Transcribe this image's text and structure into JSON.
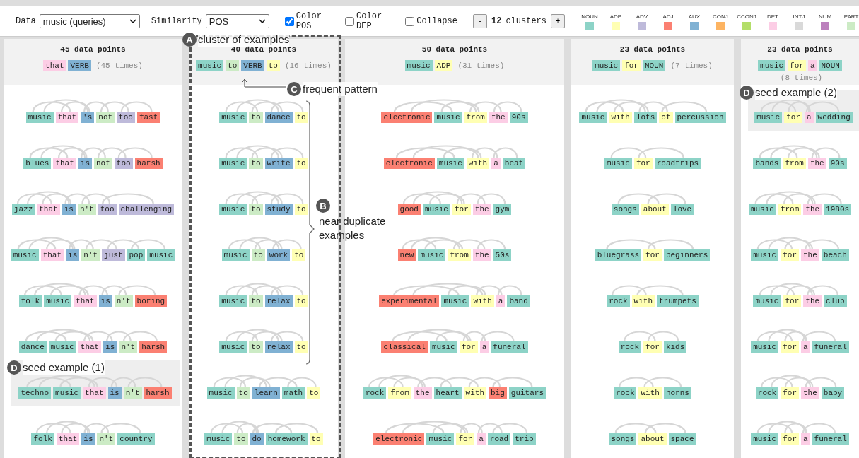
{
  "toolbar": {
    "data_label": "Data",
    "data_value": "music (queries)",
    "similarity_label": "Similarity",
    "similarity_value": "POS",
    "checkboxes": [
      {
        "label": "Color POS",
        "checked": true
      },
      {
        "label": "Color DEP",
        "checked": false
      },
      {
        "label": "Collapse",
        "checked": false
      }
    ],
    "minus": "-",
    "count": "12",
    "count_label": "clusters",
    "plus": "+"
  },
  "legend": [
    {
      "label": "NOUN",
      "color": "#8dd3c7"
    },
    {
      "label": "ADP",
      "color": "#ffffb3"
    },
    {
      "label": "ADV",
      "color": "#bebada"
    },
    {
      "label": "ADJ",
      "color": "#fb8072"
    },
    {
      "label": "AUX",
      "color": "#80b1d3"
    },
    {
      "label": "CONJ",
      "color": "#fdb462"
    },
    {
      "label": "CCONJ",
      "color": "#b3de69"
    },
    {
      "label": "DET",
      "color": "#fccde5"
    },
    {
      "label": "INTJ",
      "color": "#d9d9d9"
    },
    {
      "label": "NUM",
      "color": "#bc80bd"
    },
    {
      "label": "PART",
      "color": "#ccebc5"
    }
  ],
  "clusters": [
    {
      "count_text": "45 data points",
      "pattern": [
        {
          "text": "that",
          "color": "#fccde5"
        },
        {
          "text": "VERB",
          "color": "#80b1d3"
        }
      ],
      "times": "(45 times)",
      "examples": [
        {
          "seed": false,
          "tokens": [
            {
              "text": "music",
              "color": "#8dd3c7"
            },
            {
              "text": "that",
              "color": "#fccde5"
            },
            {
              "text": "'s",
              "color": "#80b1d3"
            },
            {
              "text": "not",
              "color": "#ccebc5"
            },
            {
              "text": "too",
              "color": "#bebada"
            },
            {
              "text": "fast",
              "color": "#fb8072"
            }
          ]
        },
        {
          "seed": false,
          "tokens": [
            {
              "text": "blues",
              "color": "#8dd3c7"
            },
            {
              "text": "that",
              "color": "#fccde5"
            },
            {
              "text": "is",
              "color": "#80b1d3"
            },
            {
              "text": "not",
              "color": "#ccebc5"
            },
            {
              "text": "too",
              "color": "#bebada"
            },
            {
              "text": "harsh",
              "color": "#fb8072"
            }
          ]
        },
        {
          "seed": false,
          "tokens": [
            {
              "text": "jazz",
              "color": "#8dd3c7"
            },
            {
              "text": "that",
              "color": "#fccde5"
            },
            {
              "text": "is",
              "color": "#80b1d3"
            },
            {
              "text": "n't",
              "color": "#ccebc5"
            },
            {
              "text": "too",
              "color": "#bebada"
            },
            {
              "text": "challenging",
              "color": "#bebada"
            }
          ]
        },
        {
          "seed": false,
          "tokens": [
            {
              "text": "music",
              "color": "#8dd3c7"
            },
            {
              "text": "that",
              "color": "#fccde5"
            },
            {
              "text": "is",
              "color": "#80b1d3"
            },
            {
              "text": "n't",
              "color": "#ccebc5"
            },
            {
              "text": "just",
              "color": "#bebada"
            },
            {
              "text": "pop",
              "color": "#8dd3c7"
            },
            {
              "text": "music",
              "color": "#8dd3c7"
            }
          ]
        },
        {
          "seed": false,
          "tokens": [
            {
              "text": "folk",
              "color": "#8dd3c7"
            },
            {
              "text": "music",
              "color": "#8dd3c7"
            },
            {
              "text": "that",
              "color": "#fccde5"
            },
            {
              "text": "is",
              "color": "#80b1d3"
            },
            {
              "text": "n't",
              "color": "#ccebc5"
            },
            {
              "text": "boring",
              "color": "#fb8072"
            }
          ]
        },
        {
          "seed": false,
          "tokens": [
            {
              "text": "dance",
              "color": "#8dd3c7"
            },
            {
              "text": "music",
              "color": "#8dd3c7"
            },
            {
              "text": "that",
              "color": "#fccde5"
            },
            {
              "text": "is",
              "color": "#80b1d3"
            },
            {
              "text": "n't",
              "color": "#ccebc5"
            },
            {
              "text": "harsh",
              "color": "#fb8072"
            }
          ]
        },
        {
          "seed": true,
          "tokens": [
            {
              "text": "techno",
              "color": "#8dd3c7"
            },
            {
              "text": "music",
              "color": "#8dd3c7"
            },
            {
              "text": "that",
              "color": "#fccde5"
            },
            {
              "text": "is",
              "color": "#80b1d3"
            },
            {
              "text": "n't",
              "color": "#ccebc5"
            },
            {
              "text": "harsh",
              "color": "#fb8072"
            }
          ]
        },
        {
          "seed": false,
          "tokens": [
            {
              "text": "folk",
              "color": "#8dd3c7"
            },
            {
              "text": "that",
              "color": "#fccde5"
            },
            {
              "text": "is",
              "color": "#80b1d3"
            },
            {
              "text": "n't",
              "color": "#ccebc5"
            },
            {
              "text": "country",
              "color": "#8dd3c7"
            }
          ]
        }
      ]
    },
    {
      "count_text": "40 data points",
      "pattern": [
        {
          "text": "music",
          "color": "#8dd3c7"
        },
        {
          "text": "to",
          "color": "#ccebc5"
        },
        {
          "text": "VERB",
          "color": "#80b1d3"
        },
        {
          "text": "to",
          "color": "#ffffb3"
        }
      ],
      "times": "(16 times)",
      "examples": [
        {
          "seed": false,
          "tokens": [
            {
              "text": "music",
              "color": "#8dd3c7"
            },
            {
              "text": "to",
              "color": "#ccebc5"
            },
            {
              "text": "dance",
              "color": "#80b1d3"
            },
            {
              "text": "to",
              "color": "#ffffb3"
            }
          ]
        },
        {
          "seed": false,
          "tokens": [
            {
              "text": "music",
              "color": "#8dd3c7"
            },
            {
              "text": "to",
              "color": "#ccebc5"
            },
            {
              "text": "write",
              "color": "#80b1d3"
            },
            {
              "text": "to",
              "color": "#ffffb3"
            }
          ]
        },
        {
          "seed": false,
          "tokens": [
            {
              "text": "music",
              "color": "#8dd3c7"
            },
            {
              "text": "to",
              "color": "#ccebc5"
            },
            {
              "text": "study",
              "color": "#80b1d3"
            },
            {
              "text": "to",
              "color": "#ffffb3"
            }
          ]
        },
        {
          "seed": false,
          "tokens": [
            {
              "text": "music",
              "color": "#8dd3c7"
            },
            {
              "text": "to",
              "color": "#ccebc5"
            },
            {
              "text": "work",
              "color": "#80b1d3"
            },
            {
              "text": "to",
              "color": "#ffffb3"
            }
          ]
        },
        {
          "seed": false,
          "tokens": [
            {
              "text": "music",
              "color": "#8dd3c7"
            },
            {
              "text": "to",
              "color": "#ccebc5"
            },
            {
              "text": "relax",
              "color": "#80b1d3"
            },
            {
              "text": "to",
              "color": "#ffffb3"
            }
          ]
        },
        {
          "seed": false,
          "tokens": [
            {
              "text": "music",
              "color": "#8dd3c7"
            },
            {
              "text": "to",
              "color": "#ccebc5"
            },
            {
              "text": "relax",
              "color": "#80b1d3"
            },
            {
              "text": "to",
              "color": "#ffffb3"
            }
          ]
        },
        {
          "seed": false,
          "tokens": [
            {
              "text": "music",
              "color": "#8dd3c7"
            },
            {
              "text": "to",
              "color": "#ccebc5"
            },
            {
              "text": "learn",
              "color": "#80b1d3"
            },
            {
              "text": "math",
              "color": "#8dd3c7"
            },
            {
              "text": "to",
              "color": "#ffffb3"
            }
          ]
        },
        {
          "seed": false,
          "tokens": [
            {
              "text": "music",
              "color": "#8dd3c7"
            },
            {
              "text": "to",
              "color": "#ccebc5"
            },
            {
              "text": "do",
              "color": "#80b1d3"
            },
            {
              "text": "homework",
              "color": "#8dd3c7"
            },
            {
              "text": "to",
              "color": "#ffffb3"
            }
          ]
        }
      ]
    },
    {
      "count_text": "50 data points",
      "pattern": [
        {
          "text": "music",
          "color": "#8dd3c7"
        },
        {
          "text": "ADP",
          "color": "#ffffb3"
        }
      ],
      "times": "(31 times)",
      "examples": [
        {
          "seed": false,
          "tokens": [
            {
              "text": "electronic",
              "color": "#fb8072"
            },
            {
              "text": "music",
              "color": "#8dd3c7"
            },
            {
              "text": "from",
              "color": "#ffffb3"
            },
            {
              "text": "the",
              "color": "#fccde5"
            },
            {
              "text": "90s",
              "color": "#8dd3c7"
            }
          ]
        },
        {
          "seed": false,
          "tokens": [
            {
              "text": "electronic",
              "color": "#fb8072"
            },
            {
              "text": "music",
              "color": "#8dd3c7"
            },
            {
              "text": "with",
              "color": "#ffffb3"
            },
            {
              "text": "a",
              "color": "#fccde5"
            },
            {
              "text": "beat",
              "color": "#8dd3c7"
            }
          ]
        },
        {
          "seed": false,
          "tokens": [
            {
              "text": "good",
              "color": "#fb8072"
            },
            {
              "text": "music",
              "color": "#8dd3c7"
            },
            {
              "text": "for",
              "color": "#ffffb3"
            },
            {
              "text": "the",
              "color": "#fccde5"
            },
            {
              "text": "gym",
              "color": "#8dd3c7"
            }
          ]
        },
        {
          "seed": false,
          "tokens": [
            {
              "text": "new",
              "color": "#fb8072"
            },
            {
              "text": "music",
              "color": "#8dd3c7"
            },
            {
              "text": "from",
              "color": "#ffffb3"
            },
            {
              "text": "the",
              "color": "#fccde5"
            },
            {
              "text": "50s",
              "color": "#8dd3c7"
            }
          ]
        },
        {
          "seed": false,
          "tokens": [
            {
              "text": "experimental",
              "color": "#fb8072"
            },
            {
              "text": "music",
              "color": "#8dd3c7"
            },
            {
              "text": "with",
              "color": "#ffffb3"
            },
            {
              "text": "a",
              "color": "#fccde5"
            },
            {
              "text": "band",
              "color": "#8dd3c7"
            }
          ]
        },
        {
          "seed": false,
          "tokens": [
            {
              "text": "classical",
              "color": "#fb8072"
            },
            {
              "text": "music",
              "color": "#8dd3c7"
            },
            {
              "text": "for",
              "color": "#ffffb3"
            },
            {
              "text": "a",
              "color": "#fccde5"
            },
            {
              "text": "funeral",
              "color": "#8dd3c7"
            }
          ]
        },
        {
          "seed": false,
          "tokens": [
            {
              "text": "rock",
              "color": "#8dd3c7"
            },
            {
              "text": "from",
              "color": "#ffffb3"
            },
            {
              "text": "the",
              "color": "#fccde5"
            },
            {
              "text": "heart",
              "color": "#8dd3c7"
            },
            {
              "text": "with",
              "color": "#ffffb3"
            },
            {
              "text": "big",
              "color": "#fb8072"
            },
            {
              "text": "guitars",
              "color": "#8dd3c7"
            }
          ]
        },
        {
          "seed": false,
          "tokens": [
            {
              "text": "electronic",
              "color": "#fb8072"
            },
            {
              "text": "music",
              "color": "#8dd3c7"
            },
            {
              "text": "for",
              "color": "#ffffb3"
            },
            {
              "text": "a",
              "color": "#fccde5"
            },
            {
              "text": "road",
              "color": "#8dd3c7"
            },
            {
              "text": "trip",
              "color": "#8dd3c7"
            }
          ]
        }
      ]
    },
    {
      "count_text": "23 data points",
      "pattern": [
        {
          "text": "music",
          "color": "#8dd3c7"
        },
        {
          "text": "for",
          "color": "#ffffb3"
        },
        {
          "text": "NOUN",
          "color": "#8dd3c7"
        }
      ],
      "times": "(7 times)",
      "examples": [
        {
          "seed": false,
          "tokens": [
            {
              "text": "music",
              "color": "#8dd3c7"
            },
            {
              "text": "with",
              "color": "#ffffb3"
            },
            {
              "text": "lots",
              "color": "#8dd3c7"
            },
            {
              "text": "of",
              "color": "#ffffb3"
            },
            {
              "text": "percussion",
              "color": "#8dd3c7"
            }
          ]
        },
        {
          "seed": false,
          "tokens": [
            {
              "text": "music",
              "color": "#8dd3c7"
            },
            {
              "text": "for",
              "color": "#ffffb3"
            },
            {
              "text": "roadtrips",
              "color": "#8dd3c7"
            }
          ]
        },
        {
          "seed": false,
          "tokens": [
            {
              "text": "songs",
              "color": "#8dd3c7"
            },
            {
              "text": "about",
              "color": "#ffffb3"
            },
            {
              "text": "love",
              "color": "#8dd3c7"
            }
          ]
        },
        {
          "seed": false,
          "tokens": [
            {
              "text": "bluegrass",
              "color": "#8dd3c7"
            },
            {
              "text": "for",
              "color": "#ffffb3"
            },
            {
              "text": "beginners",
              "color": "#8dd3c7"
            }
          ]
        },
        {
          "seed": false,
          "tokens": [
            {
              "text": "rock",
              "color": "#8dd3c7"
            },
            {
              "text": "with",
              "color": "#ffffb3"
            },
            {
              "text": "trumpets",
              "color": "#8dd3c7"
            }
          ]
        },
        {
          "seed": false,
          "tokens": [
            {
              "text": "rock",
              "color": "#8dd3c7"
            },
            {
              "text": "for",
              "color": "#ffffb3"
            },
            {
              "text": "kids",
              "color": "#8dd3c7"
            }
          ]
        },
        {
          "seed": false,
          "tokens": [
            {
              "text": "rock",
              "color": "#8dd3c7"
            },
            {
              "text": "with",
              "color": "#ffffb3"
            },
            {
              "text": "horns",
              "color": "#8dd3c7"
            }
          ]
        },
        {
          "seed": false,
          "tokens": [
            {
              "text": "songs",
              "color": "#8dd3c7"
            },
            {
              "text": "about",
              "color": "#ffffb3"
            },
            {
              "text": "space",
              "color": "#8dd3c7"
            }
          ]
        }
      ]
    },
    {
      "count_text": "23 data points",
      "pattern": [
        {
          "text": "music",
          "color": "#8dd3c7"
        },
        {
          "text": "for",
          "color": "#ffffb3"
        },
        {
          "text": "a",
          "color": "#fccde5"
        },
        {
          "text": "NOUN",
          "color": "#8dd3c7"
        }
      ],
      "times": "(8 times)",
      "examples": [
        {
          "seed": true,
          "tokens": [
            {
              "text": "music",
              "color": "#8dd3c7"
            },
            {
              "text": "for",
              "color": "#ffffb3"
            },
            {
              "text": "a",
              "color": "#fccde5"
            },
            {
              "text": "wedding",
              "color": "#8dd3c7"
            }
          ]
        },
        {
          "seed": false,
          "tokens": [
            {
              "text": "bands",
              "color": "#8dd3c7"
            },
            {
              "text": "from",
              "color": "#ffffb3"
            },
            {
              "text": "the",
              "color": "#fccde5"
            },
            {
              "text": "90s",
              "color": "#8dd3c7"
            }
          ]
        },
        {
          "seed": false,
          "tokens": [
            {
              "text": "music",
              "color": "#8dd3c7"
            },
            {
              "text": "from",
              "color": "#ffffb3"
            },
            {
              "text": "the",
              "color": "#fccde5"
            },
            {
              "text": "1980s",
              "color": "#8dd3c7"
            }
          ]
        },
        {
          "seed": false,
          "tokens": [
            {
              "text": "music",
              "color": "#8dd3c7"
            },
            {
              "text": "for",
              "color": "#ffffb3"
            },
            {
              "text": "the",
              "color": "#fccde5"
            },
            {
              "text": "beach",
              "color": "#8dd3c7"
            }
          ]
        },
        {
          "seed": false,
          "tokens": [
            {
              "text": "music",
              "color": "#8dd3c7"
            },
            {
              "text": "for",
              "color": "#ffffb3"
            },
            {
              "text": "the",
              "color": "#fccde5"
            },
            {
              "text": "club",
              "color": "#8dd3c7"
            }
          ]
        },
        {
          "seed": false,
          "tokens": [
            {
              "text": "music",
              "color": "#8dd3c7"
            },
            {
              "text": "for",
              "color": "#ffffb3"
            },
            {
              "text": "a",
              "color": "#fccde5"
            },
            {
              "text": "funeral",
              "color": "#8dd3c7"
            }
          ]
        },
        {
          "seed": false,
          "tokens": [
            {
              "text": "rock",
              "color": "#8dd3c7"
            },
            {
              "text": "for",
              "color": "#ffffb3"
            },
            {
              "text": "the",
              "color": "#fccde5"
            },
            {
              "text": "baby",
              "color": "#8dd3c7"
            }
          ]
        },
        {
          "seed": false,
          "tokens": [
            {
              "text": "music",
              "color": "#8dd3c7"
            },
            {
              "text": "for",
              "color": "#ffffb3"
            },
            {
              "text": "a",
              "color": "#fccde5"
            },
            {
              "text": "funeral",
              "color": "#8dd3c7"
            }
          ]
        }
      ]
    }
  ],
  "annotations": [
    {
      "kind": "cluster",
      "letter": "A",
      "text": "cluster of examples"
    },
    {
      "kind": "pattern",
      "letter": "C",
      "text": "frequent pattern"
    },
    {
      "kind": "duplicates",
      "letter": "B",
      "text": "near duplicate examples"
    },
    {
      "kind": "seed",
      "letter": "D",
      "text": "seed example (1)"
    },
    {
      "kind": "seed",
      "letter": "D",
      "text": "seed example (2)"
    }
  ]
}
